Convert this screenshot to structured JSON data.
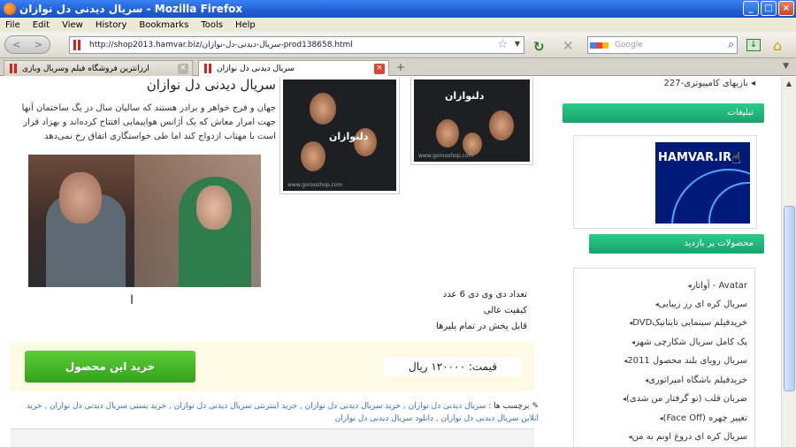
{
  "window": {
    "title": "سریال دیدنی دل نوازان - Mozilla Firefox",
    "controls": [
      "_",
      "□",
      "×"
    ]
  },
  "menu": [
    "File",
    "Edit",
    "View",
    "History",
    "Bookmarks",
    "Tools",
    "Help"
  ],
  "nav": {
    "back": "<",
    "forward": ">",
    "url": "http://shop2013.hamvar.biz/سریال-دیدنی-دل-نوازان-prod138658.html",
    "search_placeholder": "Google"
  },
  "tabs": [
    {
      "label": "ارزانترین فروشگاه فیلم وسریال وبازی",
      "active": false
    },
    {
      "label": "سریال دیدنی دل نوازان",
      "active": true
    }
  ],
  "product": {
    "title": "سریال دیدنی دل نوازان",
    "description": "جهان و فرج خواهر و برادر هستند که سالیان سال در یگ ساختمان آنها جهت امرار معاش که یک آژانس هواپیمایی افتتاح کرده‌اند و بهزاد قرار است با مهتاب ازدواج کند اما طی خواستگاری اتفاق رخ نمی‌دهد",
    "poster_title": "دلنوازان",
    "poster_site": "www.gorooshop.com",
    "features": [
      "تعداد دی وی دی 6 عدد",
      "کیفیت عالی",
      "قابل پخش در تمام پلیرها"
    ],
    "buy_label": "خرید این محصول",
    "price_label": "قیمت:",
    "price_value": "۱۲۰۰۰۰ ریال"
  },
  "tags": {
    "label": "برچسب ها :",
    "items": [
      "سریال دیدنی دل نوازان",
      "خرید سریال دیدنی دل نوازان",
      "خرید اینترنتی سریال دیدنی دل نوازان",
      "خرید پستی سریال دیدنی دل نوازان",
      "خرید انلاین سریال دیدنی دل نوازان",
      "دانلود سریال دیدنی دل نوازان"
    ]
  },
  "sidebar": {
    "top_link": "بازیهای کامپیوتری-227",
    "ads_title": "تبلیغات",
    "banner_text": "HAMVAR.IR",
    "visited_title": "محصولات پر بازدید",
    "visited": [
      "Avatar - آواتار",
      "سریال کره ای رز زیبایی",
      "خریدفیلم سینمایی تایتانیکDVD",
      "پک کامل سریال شکارچی شهر",
      "سریال رویای بلند محصول 2011",
      "خریدفیلم باشگاه امپراتوری",
      "ضربان قلب (نو گرفتار من شدی)",
      "تغییر چهره (Face Off)",
      "سریال کره ای دروغ اونم به من"
    ]
  }
}
